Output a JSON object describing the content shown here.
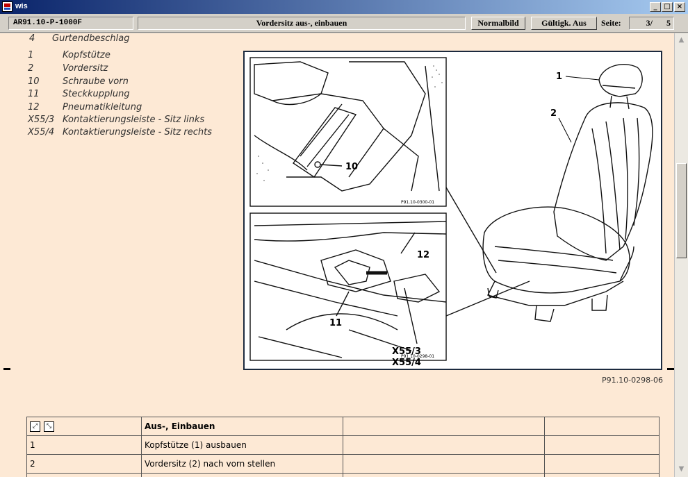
{
  "window": {
    "title": "wis"
  },
  "toolbar": {
    "doc_code": "AR91.10-P-1000F",
    "doc_title": "Vordersitz aus-, einbauen",
    "normalbild_label": "Normalbild",
    "gueltigk_label": "Gültigk. Aus",
    "seite_label": "Seite:",
    "page_current": "3/",
    "page_total": "5"
  },
  "legend": {
    "top_item": {
      "num": "4",
      "text": "Gurtendbeschlag"
    },
    "items": [
      {
        "num": "1",
        "text": "Kopfstütze"
      },
      {
        "num": "2",
        "text": "Vordersitz"
      },
      {
        "num": "10",
        "text": "Schraube vorn"
      },
      {
        "num": "11",
        "text": "Steckkupplung"
      },
      {
        "num": "12",
        "text": "Pneumatikleitung"
      },
      {
        "num": "X55/3",
        "text": "Kontaktierungsleiste - Sitz links"
      },
      {
        "num": "X55/4",
        "text": "Kontaktierungsleiste - Sitz rechts"
      }
    ]
  },
  "figure": {
    "caption": "P91.10-0298-06",
    "callouts": {
      "c1": "1",
      "c2": "2",
      "c10": "10",
      "c11": "11",
      "c12": "12",
      "x553": "X55/3",
      "x554": "X55/4"
    },
    "detail_top_code": "P91.10-0300-01",
    "detail_bottom_code": "P91.10-0298-01"
  },
  "table": {
    "header": "Aus-, Einbauen",
    "rows": [
      {
        "num": "1",
        "text": "Kopfstütze (1) ausbauen"
      },
      {
        "num": "2",
        "text": "Vordersitz (2) nach vorn stellen"
      }
    ]
  },
  "icons": {
    "expand": "expand-all-icon",
    "collapse": "collapse-all-icon"
  }
}
